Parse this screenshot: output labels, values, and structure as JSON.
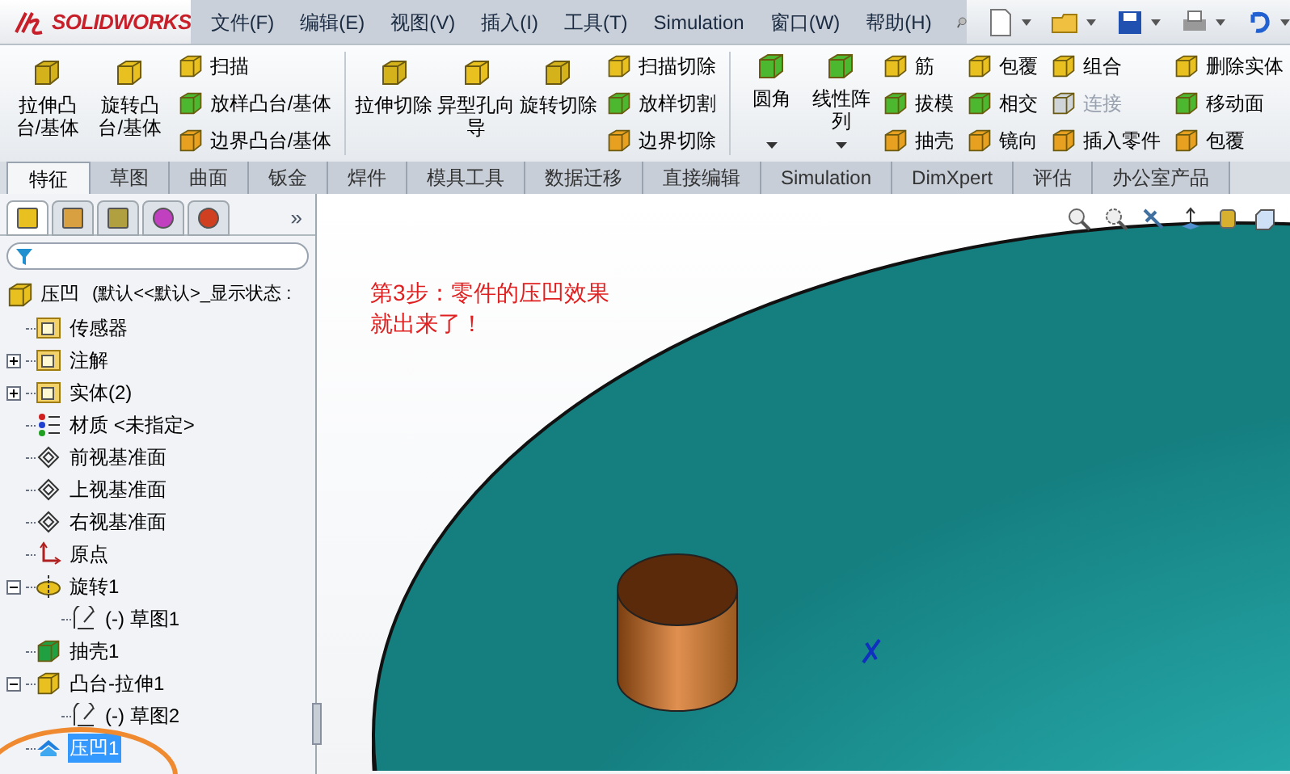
{
  "app": {
    "logo": "SOLIDWORKS"
  },
  "menu": [
    "文件(F)",
    "编辑(E)",
    "视图(V)",
    "插入(I)",
    "工具(T)",
    "Simulation",
    "窗口(W)",
    "帮助(H)"
  ],
  "ribbon": [
    {
      "kind": "large",
      "label": "拉伸凸台/基体"
    },
    {
      "kind": "large",
      "label": "旋转凸台/基体"
    },
    {
      "kind": "column",
      "items": [
        {
          "label": "扫描",
          "disabled": false
        },
        {
          "label": "放样凸台/基体",
          "disabled": false
        },
        {
          "label": "边界凸台/基体",
          "disabled": false
        }
      ]
    },
    {
      "kind": "separator"
    },
    {
      "kind": "large",
      "label": "拉伸切除"
    },
    {
      "kind": "large",
      "label": "异型孔向导"
    },
    {
      "kind": "large",
      "label": "旋转切除"
    },
    {
      "kind": "column",
      "items": [
        {
          "label": "扫描切除",
          "disabled": false
        },
        {
          "label": "放样切割",
          "disabled": false
        },
        {
          "label": "边界切除",
          "disabled": false
        }
      ]
    },
    {
      "kind": "separator"
    },
    {
      "kind": "dropdown",
      "label": "圆角"
    },
    {
      "kind": "dropdown",
      "label": "线性阵列"
    },
    {
      "kind": "column",
      "items": [
        {
          "label": "筋",
          "disabled": false
        },
        {
          "label": "拔模",
          "disabled": false
        },
        {
          "label": "抽壳",
          "disabled": false
        }
      ]
    },
    {
      "kind": "column",
      "items": [
        {
          "label": "包覆",
          "disabled": false
        },
        {
          "label": "相交",
          "disabled": false
        },
        {
          "label": "镜向",
          "disabled": false
        }
      ]
    },
    {
      "kind": "column",
      "items": [
        {
          "label": "组合",
          "disabled": false
        },
        {
          "label": "连接",
          "disabled": true
        },
        {
          "label": "插入零件",
          "disabled": false
        }
      ]
    },
    {
      "kind": "column",
      "items": [
        {
          "label": "删除实体",
          "disabled": false
        },
        {
          "label": "移动面",
          "disabled": false
        },
        {
          "label": "包覆",
          "disabled": false
        }
      ]
    }
  ],
  "tabs": [
    {
      "label": "特征",
      "selected": true
    },
    {
      "label": "草图",
      "selected": false
    },
    {
      "label": "曲面",
      "selected": false
    },
    {
      "label": "钣金",
      "selected": false
    },
    {
      "label": "焊件",
      "selected": false
    },
    {
      "label": "模具工具",
      "selected": false
    },
    {
      "label": "数据迁移",
      "selected": false
    },
    {
      "label": "直接编辑",
      "selected": false
    },
    {
      "label": "Simulation",
      "selected": false
    },
    {
      "label": "DimXpert",
      "selected": false
    },
    {
      "label": "评估",
      "selected": false
    },
    {
      "label": "办公室产品",
      "selected": false
    }
  ],
  "panel": {
    "tabs": [
      {
        "selected": true
      },
      {
        "selected": false
      },
      {
        "selected": false
      },
      {
        "selected": false
      },
      {
        "selected": false
      }
    ],
    "more": "»",
    "root": {
      "label": "压凹",
      "config": "(默认<<默认>_显示状态 :"
    },
    "tree": [
      {
        "label": "传感器",
        "kind": "folder",
        "selected": false
      },
      {
        "label": "注解",
        "kind": "folder",
        "expanded": false,
        "selected": false
      },
      {
        "label": "实体(2)",
        "kind": "folder",
        "expanded": false,
        "selected": false
      },
      {
        "label": "材质 <未指定>",
        "kind": "material",
        "selected": false
      },
      {
        "label": "前视基准面",
        "kind": "plane",
        "selected": false
      },
      {
        "label": "上视基准面",
        "kind": "plane",
        "selected": false
      },
      {
        "label": "右视基准面",
        "kind": "plane",
        "selected": false
      },
      {
        "label": "原点",
        "kind": "origin",
        "selected": false
      },
      {
        "label": "旋转1",
        "kind": "revolve",
        "expanded": true,
        "selected": false,
        "children": [
          {
            "label": "(-) 草图1",
            "kind": "sketch",
            "selected": false
          }
        ]
      },
      {
        "label": "抽壳1",
        "kind": "shell",
        "selected": false
      },
      {
        "label": "凸台-拉伸1",
        "kind": "extrude",
        "expanded": true,
        "selected": false,
        "children": [
          {
            "label": "(-) 草图2",
            "kind": "sketch",
            "selected": false
          }
        ]
      },
      {
        "label": "压凹1",
        "kind": "indent",
        "selected": true
      }
    ]
  },
  "viewport": {
    "note": "第3步：零件的压凹效果就出来了！"
  }
}
